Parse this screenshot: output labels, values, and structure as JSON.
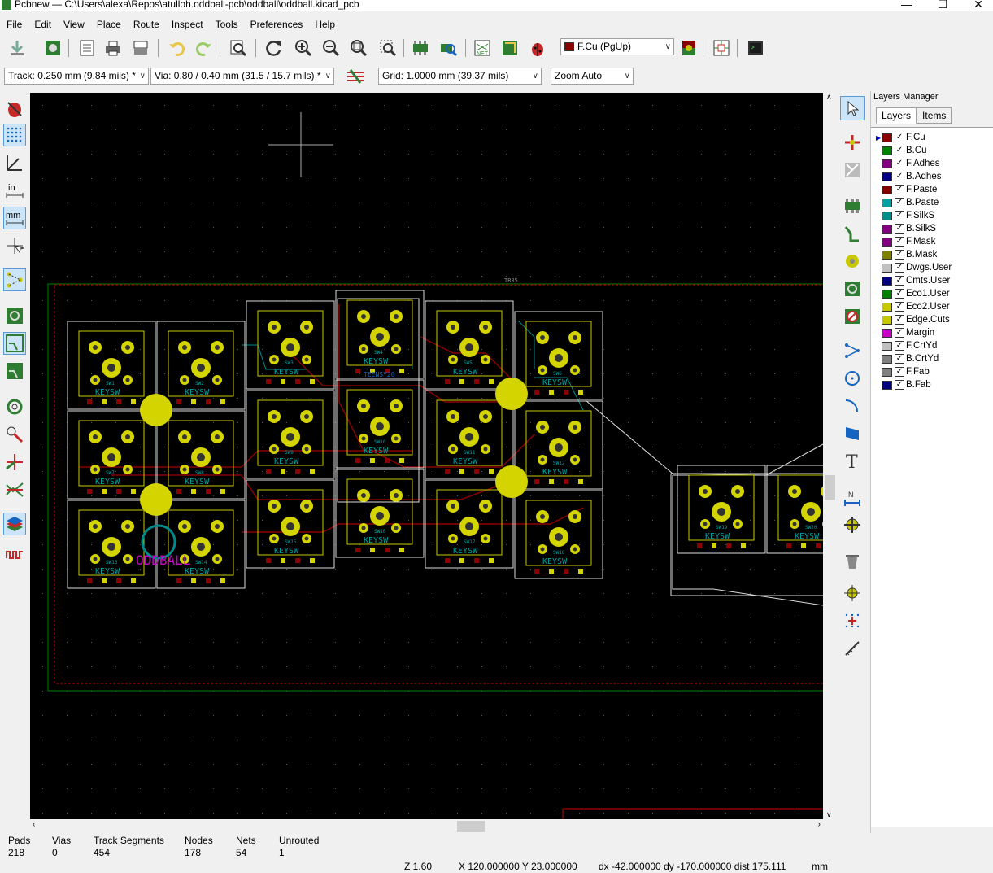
{
  "window": {
    "title": "Pcbnew — C:\\Users\\alexa\\Repos\\atulloh.oddball-pcb\\oddball\\oddball.kicad_pcb"
  },
  "menu": [
    "File",
    "Edit",
    "View",
    "Place",
    "Route",
    "Inspect",
    "Tools",
    "Preferences",
    "Help"
  ],
  "toolbar": {
    "active_layer": "F.Cu (PgUp)",
    "track": "Track: 0.250 mm (9.84 mils) *",
    "via": "Via: 0.80 / 0.40 mm (31.5 / 15.7 mils) *",
    "grid": "Grid: 1.0000 mm (39.37 mils)",
    "zoom": "Zoom Auto"
  },
  "layers_panel": {
    "title": "Layers Manager",
    "tabs": [
      "Layers",
      "Items"
    ],
    "layers": [
      {
        "name": "F.Cu",
        "color": "#8b0000"
      },
      {
        "name": "B.Cu",
        "color": "#008000"
      },
      {
        "name": "F.Adhes",
        "color": "#800080"
      },
      {
        "name": "B.Adhes",
        "color": "#000080"
      },
      {
        "name": "F.Paste",
        "color": "#800000"
      },
      {
        "name": "B.Paste",
        "color": "#00a0a0"
      },
      {
        "name": "F.SilkS",
        "color": "#008b8b"
      },
      {
        "name": "B.SilkS",
        "color": "#800080"
      },
      {
        "name": "F.Mask",
        "color": "#800080"
      },
      {
        "name": "B.Mask",
        "color": "#808000"
      },
      {
        "name": "Dwgs.User",
        "color": "#c0c0c0"
      },
      {
        "name": "Cmts.User",
        "color": "#000080"
      },
      {
        "name": "Eco1.User",
        "color": "#008000"
      },
      {
        "name": "Eco2.User",
        "color": "#c8c800"
      },
      {
        "name": "Edge.Cuts",
        "color": "#c8c800"
      },
      {
        "name": "Margin",
        "color": "#c800c8"
      },
      {
        "name": "F.CrtYd",
        "color": "#c0c0c0"
      },
      {
        "name": "B.CrtYd",
        "color": "#808080"
      },
      {
        "name": "F.Fab",
        "color": "#808080"
      },
      {
        "name": "B.Fab",
        "color": "#000080"
      }
    ]
  },
  "status": {
    "pads_label": "Pads",
    "pads": "218",
    "vias_label": "Vias",
    "vias": "0",
    "tracks_label": "Track Segments",
    "tracks": "454",
    "nodes_label": "Nodes",
    "nodes": "178",
    "nets_label": "Nets",
    "nets": "54",
    "unrouted_label": "Unrouted",
    "unrouted": "1"
  },
  "coords": {
    "zoom": "Z 1.60",
    "xy": "X 120.000000  Y 23.000000",
    "delta": "dx -42.000000  dy -170.000000  dist 175.111",
    "units": "mm"
  },
  "pcb": {
    "board_label": "TR85",
    "switches": [
      "SW1",
      "SW2",
      "SW3",
      "SW4",
      "SW5",
      "SW6",
      "SW7",
      "SW8",
      "SW9",
      "SW10",
      "SW11",
      "SW12",
      "SW13",
      "SW14",
      "SW15",
      "SW16",
      "SW17",
      "SW18",
      "SW19",
      "SW20"
    ],
    "footprint_text": "KEYSW",
    "mcu_label": "TEENSY20",
    "logo_text": "ODDBALL"
  }
}
